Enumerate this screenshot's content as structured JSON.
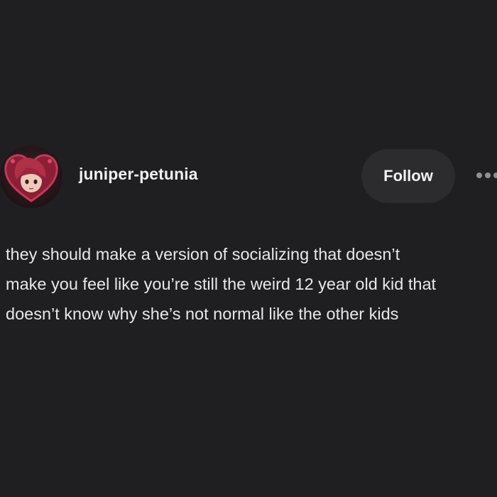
{
  "post": {
    "author": {
      "username": "juniper-petunia",
      "avatar_icon": "avatar-heart-frame-icon"
    },
    "follow_label": "Follow",
    "more_icon": "more-horizontal-icon",
    "text": "they should make a version of socializing that doesn’t\nmake you feel like you’re still the weird 12 year old kid that\ndoesn’t know why she’s not normal like the other kids"
  },
  "colors": {
    "background": "#1f1f21",
    "button_bg": "#2c2c2e",
    "text": "#e8e8e8",
    "muted_icon": "#8f8f92"
  }
}
